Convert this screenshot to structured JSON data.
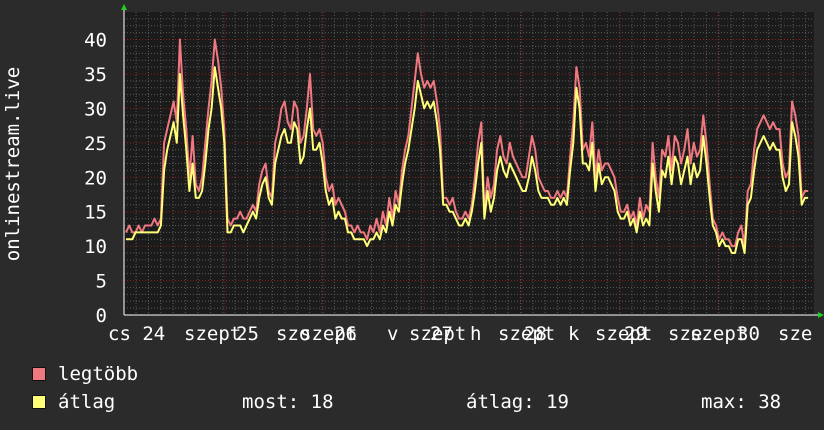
{
  "colors": {
    "background": "#2b2b2b",
    "plot_background": "#1b1b1b",
    "grid_major": "#8a1c1c",
    "grid_minor": "#5a5a5a",
    "axis_arrows": "#22cc22"
  },
  "chart_data": {
    "type": "line",
    "ylabel": "onlinestream.live",
    "ylim": [
      0,
      44
    ],
    "yticks": [
      0,
      5,
      10,
      15,
      20,
      25,
      30,
      35,
      40
    ],
    "xticks": [
      "cs 24",
      "szept",
      "25",
      "szo",
      "szept",
      "26",
      "v",
      "szept",
      "27",
      "h",
      "szept",
      "28",
      "k",
      "szept",
      "29",
      "sze",
      "szept",
      "30",
      "sze"
    ],
    "x_range": [
      0,
      175
    ],
    "series": [
      {
        "name": "legtöbb",
        "color": "#f07880",
        "values": [
          12,
          13,
          12,
          12,
          13,
          12,
          13,
          13,
          13,
          14,
          13,
          14,
          25,
          27,
          29,
          31,
          28,
          40,
          32,
          27,
          20,
          26,
          19,
          18,
          20,
          25,
          30,
          34,
          40,
          37,
          33,
          27,
          14,
          13,
          14,
          14,
          15,
          14,
          14,
          15,
          16,
          15,
          19,
          21,
          22,
          18,
          17,
          25,
          27,
          30,
          31,
          28,
          27,
          31,
          30,
          25,
          26,
          30,
          35,
          27,
          26,
          27,
          25,
          20,
          18,
          19,
          16,
          17,
          16,
          15,
          13,
          13,
          12,
          13,
          12,
          12,
          11,
          13,
          12,
          14,
          12,
          15,
          13,
          17,
          14,
          18,
          16,
          21,
          24,
          26,
          30,
          34,
          38,
          35,
          33,
          34,
          33,
          34,
          31,
          27,
          17,
          17,
          16,
          17,
          15,
          14,
          14,
          15,
          14,
          16,
          20,
          25,
          28,
          15,
          20,
          17,
          19,
          24,
          26,
          23,
          22,
          25,
          23,
          22,
          21,
          20,
          20,
          23,
          26,
          24,
          20,
          19,
          18,
          18,
          17,
          17,
          18,
          17,
          18,
          17,
          23,
          28,
          36,
          33,
          24,
          25,
          23,
          28,
          20,
          24,
          21,
          22,
          22,
          21,
          20,
          17,
          15,
          15,
          16,
          14,
          15,
          13,
          17,
          14,
          16,
          15,
          25,
          20,
          17,
          24,
          23,
          26,
          21,
          26,
          25,
          22,
          24,
          27,
          22,
          25,
          23,
          24,
          29,
          25,
          19,
          14,
          13,
          11,
          12,
          11,
          11,
          10,
          10,
          12,
          13,
          10,
          18,
          19,
          24,
          27,
          28,
          29,
          28,
          27,
          28,
          27,
          27,
          22,
          20,
          21,
          31,
          29,
          26,
          17,
          18,
          18
        ]
      },
      {
        "name": "átlag",
        "color": "#ffff78",
        "values": [
          11,
          11,
          11,
          12,
          12,
          12,
          12,
          12,
          12,
          12,
          12,
          13,
          21,
          24,
          26,
          28,
          25,
          35,
          29,
          24,
          18,
          22,
          17,
          17,
          18,
          22,
          27,
          30,
          36,
          33,
          30,
          25,
          12,
          12,
          13,
          13,
          13,
          12,
          13,
          14,
          15,
          14,
          17,
          19,
          20,
          17,
          16,
          22,
          24,
          26,
          27,
          25,
          25,
          28,
          27,
          22,
          23,
          27,
          30,
          24,
          24,
          25,
          22,
          18,
          16,
          17,
          14,
          15,
          14,
          14,
          12,
          12,
          11,
          11,
          11,
          11,
          10,
          11,
          11,
          12,
          11,
          13,
          12,
          15,
          13,
          16,
          15,
          19,
          22,
          24,
          27,
          30,
          34,
          32,
          30,
          31,
          30,
          31,
          28,
          24,
          16,
          16,
          15,
          15,
          14,
          13,
          13,
          14,
          13,
          15,
          18,
          22,
          25,
          14,
          18,
          15,
          17,
          21,
          23,
          21,
          20,
          22,
          21,
          20,
          19,
          18,
          18,
          20,
          23,
          21,
          18,
          17,
          17,
          17,
          16,
          16,
          17,
          16,
          17,
          16,
          21,
          25,
          33,
          30,
          22,
          22,
          21,
          25,
          18,
          22,
          19,
          20,
          20,
          19,
          18,
          15,
          14,
          14,
          15,
          13,
          14,
          12,
          15,
          13,
          14,
          13,
          22,
          18,
          15,
          21,
          20,
          23,
          19,
          23,
          22,
          19,
          21,
          23,
          19,
          22,
          20,
          21,
          26,
          22,
          17,
          13,
          12,
          10,
          11,
          10,
          10,
          9,
          9,
          11,
          11,
          9,
          16,
          17,
          21,
          24,
          25,
          26,
          25,
          24,
          25,
          24,
          24,
          20,
          18,
          19,
          28,
          26,
          23,
          16,
          17,
          17
        ]
      }
    ]
  },
  "legend": [
    {
      "label": "legtöbb",
      "color": "#f07880"
    },
    {
      "label": "átlag",
      "color": "#ffff78"
    }
  ],
  "stats": {
    "now": "most: 18",
    "avg": "átlag: 19",
    "max": "max: 38"
  }
}
